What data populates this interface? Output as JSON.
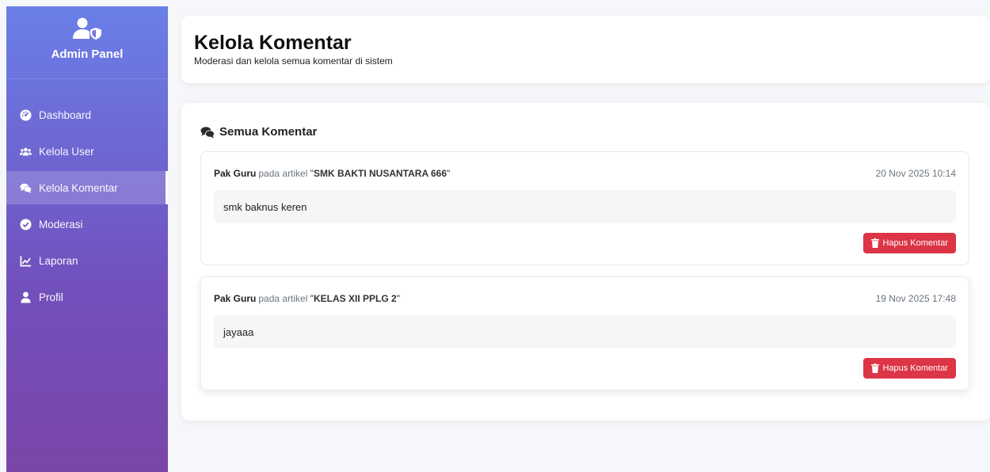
{
  "sidebar": {
    "brand_title": "Admin Panel",
    "brand_icon": "user-shield-icon",
    "items": [
      {
        "label": "Dashboard",
        "icon": "dashboard-icon",
        "active": false
      },
      {
        "label": "Kelola User",
        "icon": "users-icon",
        "active": false
      },
      {
        "label": "Kelola Komentar",
        "icon": "comments-icon",
        "active": true
      },
      {
        "label": "Moderasi",
        "icon": "check-circle-icon",
        "active": false
      },
      {
        "label": "Laporan",
        "icon": "chart-line-icon",
        "active": false
      },
      {
        "label": "Profil",
        "icon": "user-icon",
        "active": false
      }
    ]
  },
  "header": {
    "title": "Kelola Komentar",
    "subtitle": "Moderasi dan kelola semua komentar di sistem"
  },
  "main": {
    "section_title": "Semua Komentar",
    "comments": [
      {
        "author": "Pak Guru",
        "on_text": "pada artikel",
        "article": "SMK BAKTI NUSANTARA 666",
        "date": "20 Nov 2025 10:14",
        "body": "smk baknus keren",
        "delete_label": "Hapus Komentar"
      },
      {
        "author": "Pak Guru",
        "on_text": "pada artikel",
        "article": "KELAS XII PPLG 2",
        "date": "19 Nov 2025 17:48",
        "body": "jayaaa",
        "delete_label": "Hapus Komentar"
      }
    ]
  },
  "colors": {
    "sidebar_gradient_top": "#6a7fe8",
    "sidebar_gradient_bottom": "#7a46a8",
    "danger": "#dc3545",
    "comment_bg": "#f5f6f8"
  }
}
